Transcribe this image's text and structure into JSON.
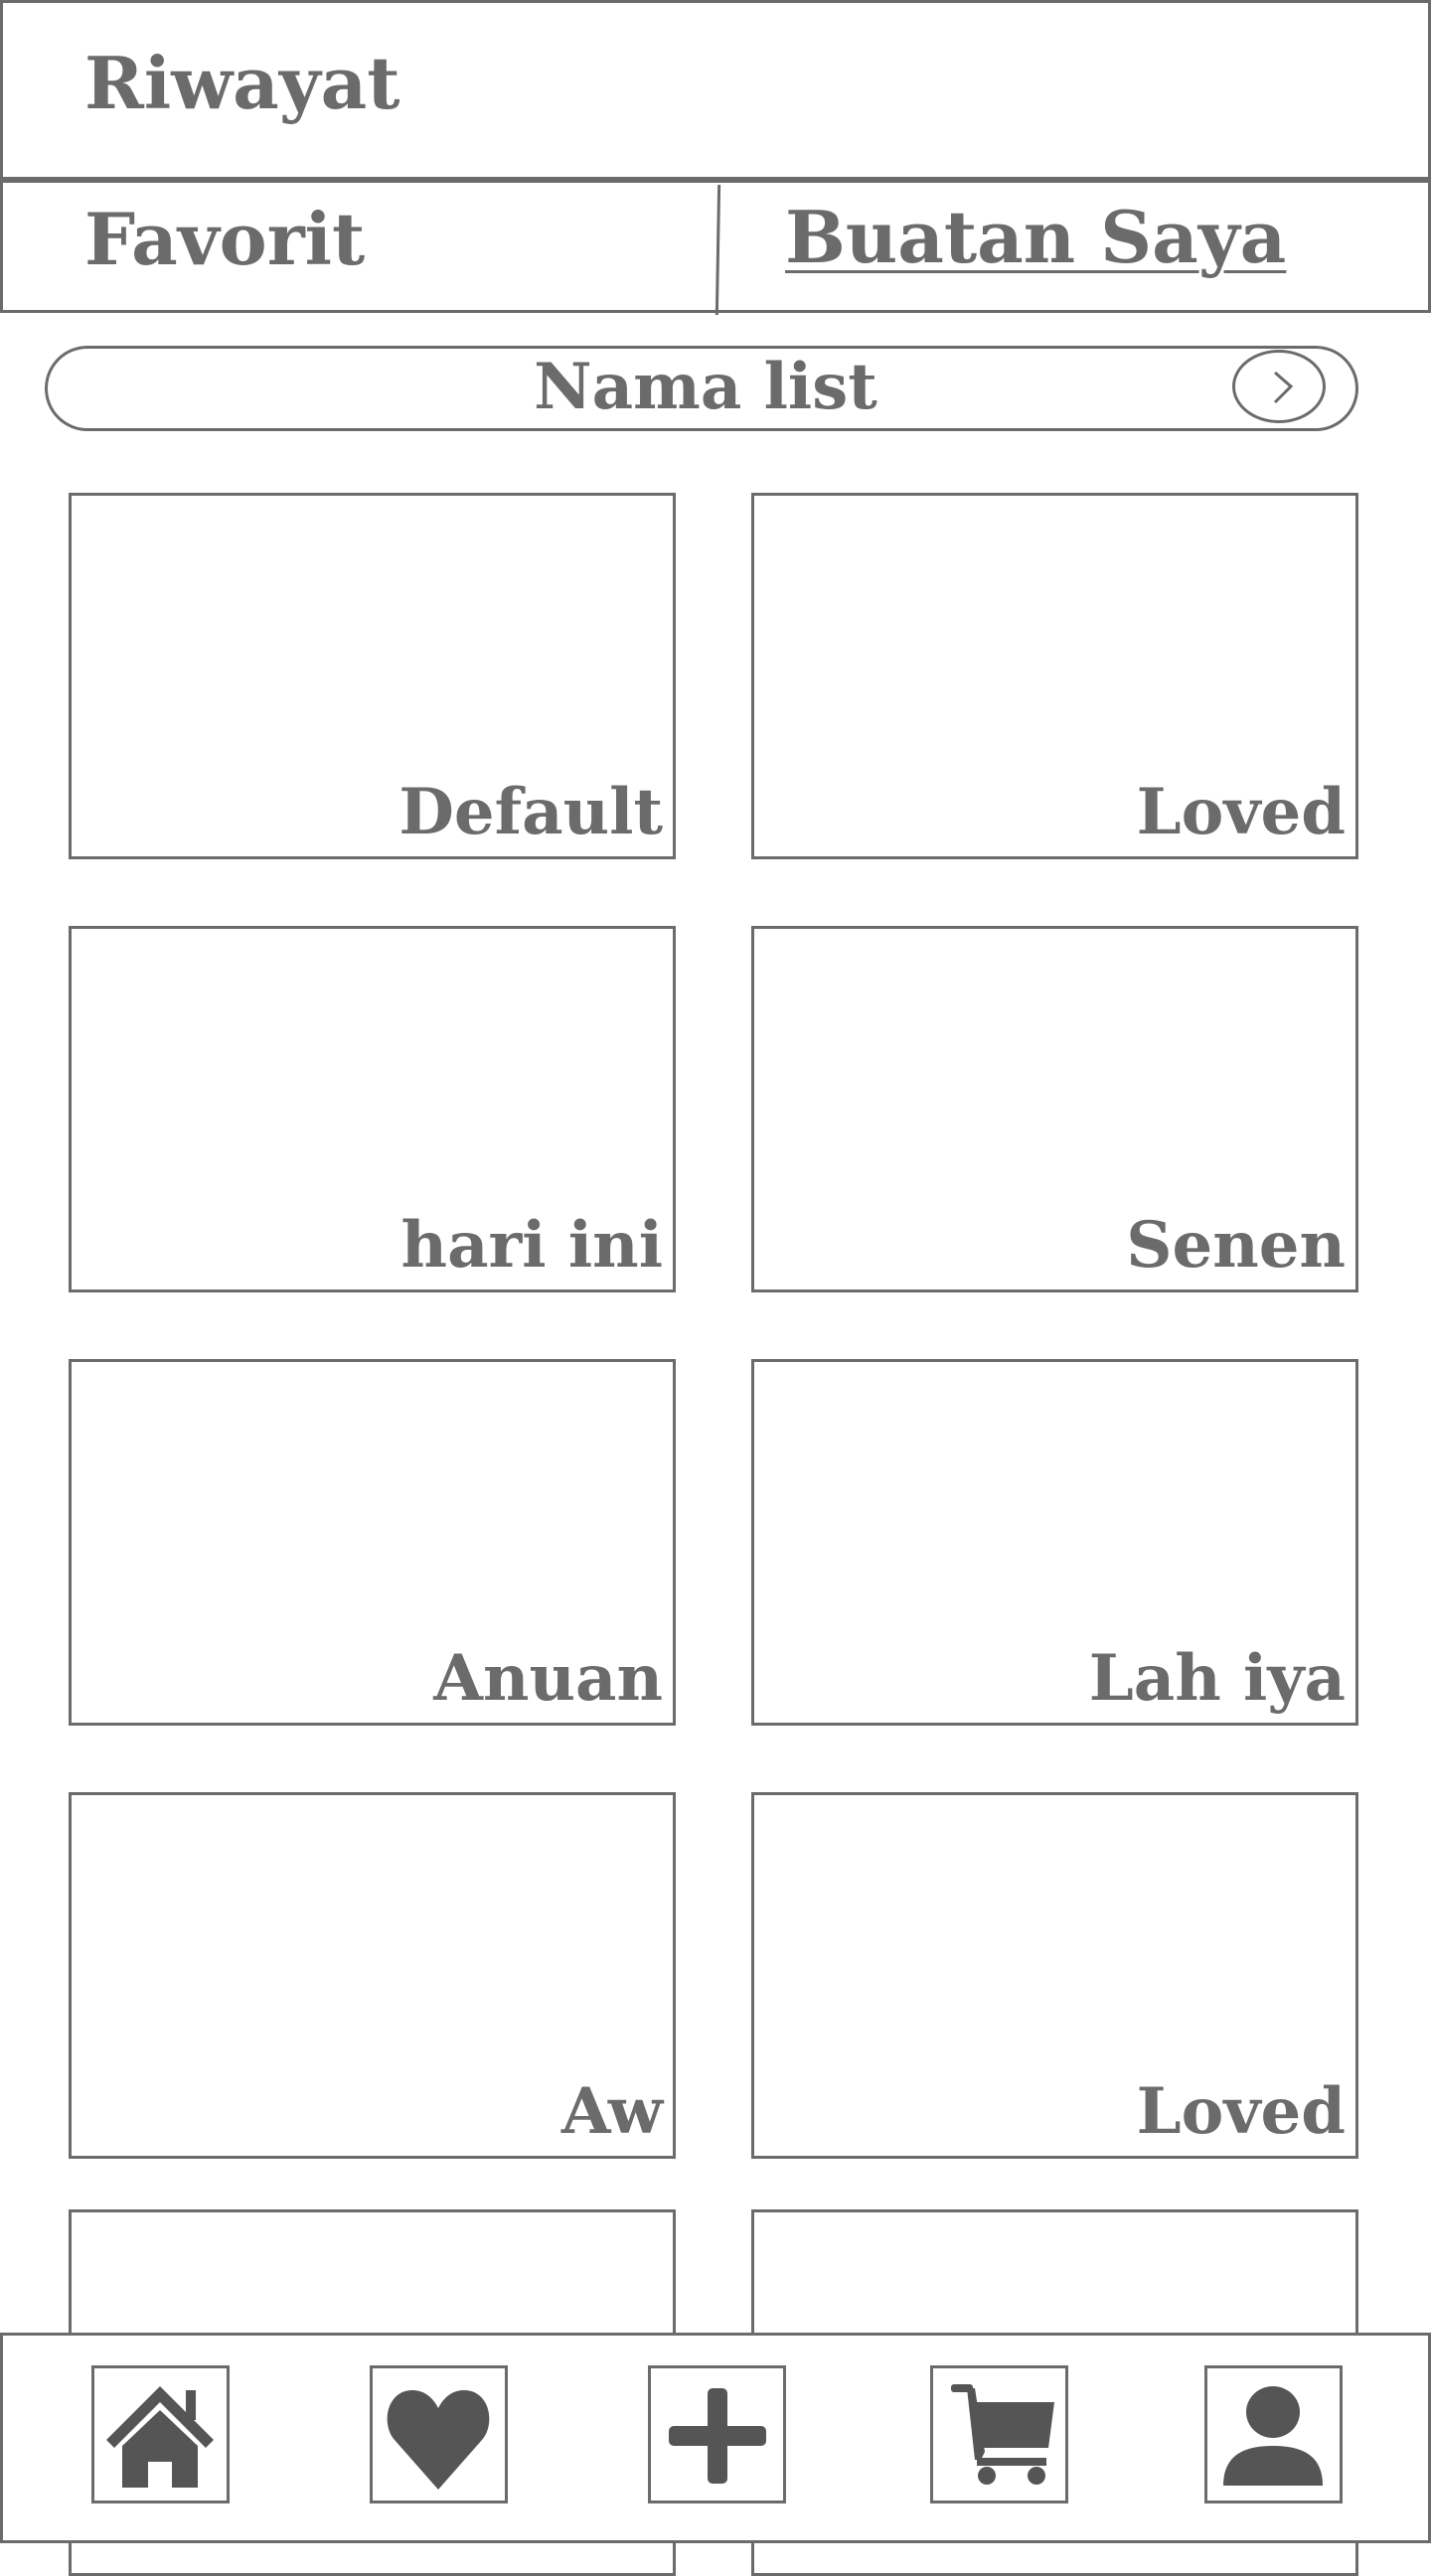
{
  "header": {
    "title": "Riwayat"
  },
  "tabs": [
    {
      "label": "Favorit"
    },
    {
      "label": "Buatan Saya"
    }
  ],
  "list_selector": {
    "label": "Nama list",
    "icon": "chevron-right-icon"
  },
  "lists": [
    {
      "label": "Default"
    },
    {
      "label": "Loved"
    },
    {
      "label": "hari ini"
    },
    {
      "label": "Senen"
    },
    {
      "label": "Anuan"
    },
    {
      "label": "Lah iya"
    },
    {
      "label": "Aw"
    },
    {
      "label": "Loved"
    },
    {
      "label": ""
    },
    {
      "label": ""
    }
  ],
  "bottom_nav": [
    {
      "icon": "home-icon"
    },
    {
      "icon": "heart-icon"
    },
    {
      "icon": "plus-icon"
    },
    {
      "icon": "cart-icon"
    },
    {
      "icon": "user-icon"
    }
  ],
  "colors": {
    "stroke": "#6b6b6b",
    "icon_fill": "#555555",
    "background": "#ffffff"
  }
}
